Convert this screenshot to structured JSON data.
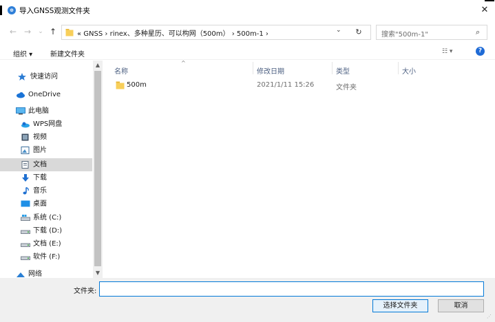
{
  "window": {
    "title": "导入GNSS观测文件夹",
    "app_icon_glyph": "⊕",
    "close_glyph": "✕"
  },
  "nav": {
    "back": "←",
    "forward": "→",
    "recent": "⌄",
    "up": "↑",
    "path_text": "« GNSS › rinex、多种星历、可以构网（500m） › 500m-1 ›",
    "dropdown": "⌄",
    "refresh": "↻",
    "search_placeholder": "搜索\"500m-1\"",
    "search_glyph": "⌕"
  },
  "toolbar": {
    "organize": "组织 ▾",
    "new_folder": "新建文件夹",
    "view": "☷ ▾",
    "help": "?"
  },
  "sidebar": {
    "items": [
      {
        "label": "快速访问",
        "icon": "star-icon"
      },
      {
        "label": "OneDrive",
        "icon": "cloud-icon"
      },
      {
        "label": "此电脑",
        "icon": "computer-icon"
      },
      {
        "label": "WPS网盘",
        "icon": "wps-cloud-icon"
      },
      {
        "label": "视频",
        "icon": "video-icon"
      },
      {
        "label": "图片",
        "icon": "pictures-icon"
      },
      {
        "label": "文档",
        "icon": "documents-icon",
        "selected": true
      },
      {
        "label": "下载",
        "icon": "download-icon"
      },
      {
        "label": "音乐",
        "icon": "music-icon"
      },
      {
        "label": "桌面",
        "icon": "desktop-icon"
      },
      {
        "label": "系统 (C:)",
        "icon": "system-drive-icon"
      },
      {
        "label": "下载 (D:)",
        "icon": "drive-icon"
      },
      {
        "label": "文档 (E:)",
        "icon": "drive-icon"
      },
      {
        "label": "软件 (F:)",
        "icon": "drive-icon"
      },
      {
        "label": "网络",
        "icon": "network-icon"
      }
    ],
    "scroll_up": "▲",
    "scroll_down": "▼"
  },
  "columns": {
    "name": "名称",
    "date": "修改日期",
    "type": "类型",
    "size": "大小",
    "sort_glyph": "^"
  },
  "files": [
    {
      "name": "500m",
      "date": "2021/1/11 15:26",
      "type": "文件夹",
      "size": ""
    }
  ],
  "footer": {
    "folder_label": "文件夹:",
    "folder_value": "",
    "select_button": "选择文件夹",
    "cancel_button": "取消",
    "grip": "⋰"
  },
  "colors": {
    "accent": "#0078d7",
    "folder": "#f8cf5a",
    "selected_bg": "#d9d9d9",
    "band": "#f0f0f0"
  }
}
